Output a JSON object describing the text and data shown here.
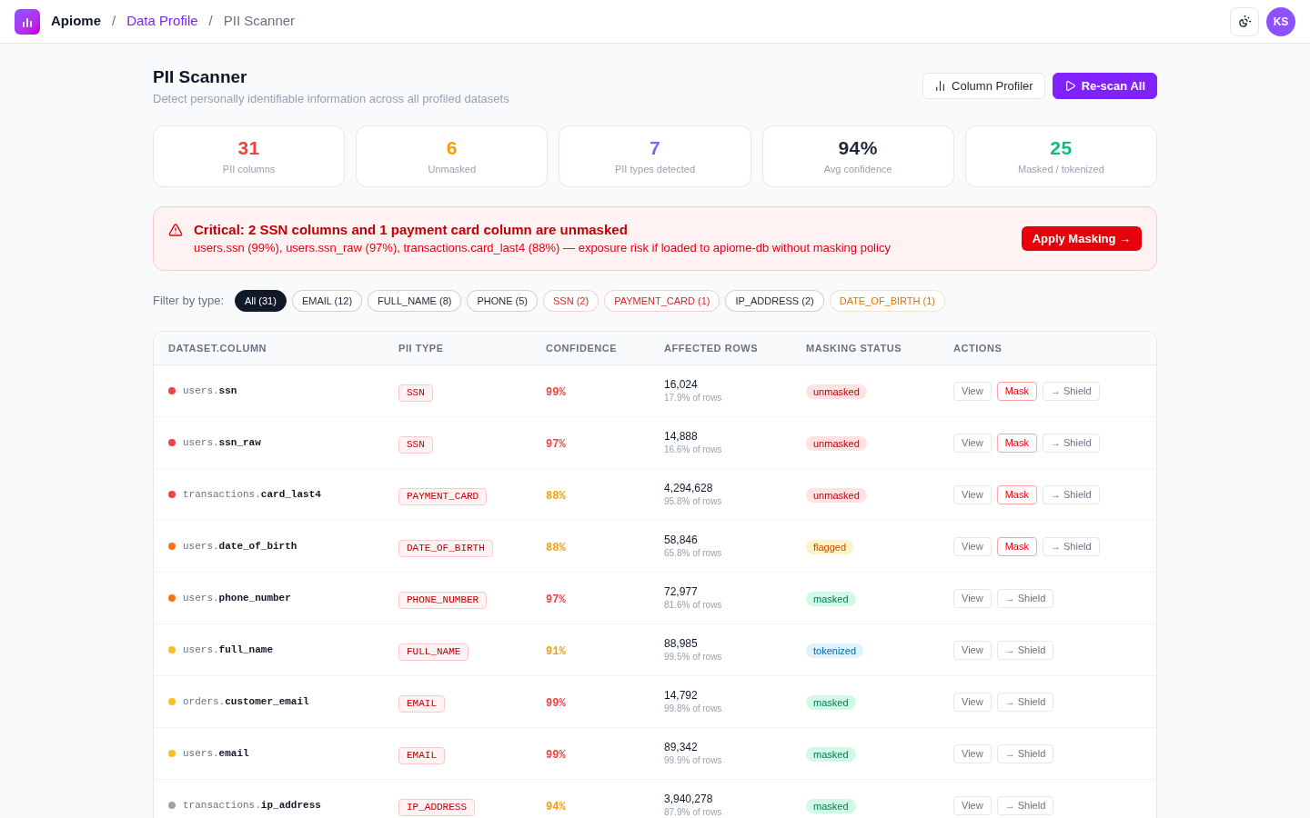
{
  "topbar": {
    "breadcrumbs": [
      {
        "label": "Apiome",
        "kind": "brand"
      },
      {
        "label": "Data Profile",
        "kind": "link",
        "separator": "/"
      },
      {
        "label": "PII Scanner",
        "kind": "current",
        "separator": "/"
      }
    ],
    "avatar": "KS"
  },
  "header": {
    "title": "PII Scanner",
    "subtitle": "Detect personally identifiable information across all profiled datasets",
    "buttons": [
      {
        "label": "Column Profiler",
        "kind": "secondary"
      },
      {
        "label": "Re-scan All",
        "kind": "primary"
      }
    ]
  },
  "stats": [
    {
      "value": "31",
      "label": "PII columns",
      "color": "#ef4444"
    },
    {
      "value": "6",
      "label": "Unmasked",
      "color": "#f59e0b"
    },
    {
      "value": "7",
      "label": "PII types detected",
      "color": "#8b5cf6"
    },
    {
      "value": "94%",
      "label": "Avg confidence",
      "color": "#1f2937"
    },
    {
      "value": "25",
      "label": "Masked / tokenized",
      "color": "#10b981"
    }
  ],
  "alert": {
    "title": "Critical: 2 SSN columns and 1 payment card column are unmasked",
    "detail": "users.ssn (99%), users.ssn_raw (97%), transactions.card_last4 (88%) — exposure risk if loaded to apiome-db without masking policy",
    "action": "Apply Masking →"
  },
  "filters": {
    "label": "Filter by type:",
    "options": [
      {
        "label": "All (31)",
        "selected": true,
        "color": "#111827"
      },
      {
        "label": "EMAIL (12)",
        "selected": false,
        "color": "#1f2937"
      },
      {
        "label": "FULL_NAME (8)",
        "selected": false,
        "color": "#1f2937"
      },
      {
        "label": "PHONE (5)",
        "selected": false,
        "color": "#1f2937"
      },
      {
        "label": "SSN (2)",
        "selected": false,
        "color": "#dc2626"
      },
      {
        "label": "PAYMENT_CARD (1)",
        "selected": false,
        "color": "#dc2626"
      },
      {
        "label": "IP_ADDRESS (2)",
        "selected": false,
        "color": "#1f2937"
      },
      {
        "label": "DATE_OF_BIRTH (1)",
        "selected": false,
        "color": "#d97706"
      }
    ]
  },
  "table": {
    "columns": [
      "DATASET.COLUMN",
      "PII TYPE",
      "CONFIDENCE",
      "AFFECTED ROWS",
      "MASKING STATUS",
      "ACTIONS"
    ],
    "rows": [
      {
        "column": "users.**ssn**",
        "color": "#ef4444",
        "pii_type": "SSN",
        "confidence": {
          "text": "99%",
          "color": "#ef4444"
        },
        "affected": "16,024",
        "share": "17.9% of rows",
        "status": {
          "label": "unmasked",
          "kind": "danger"
        },
        "actions": [
          {
            "label": "View",
            "kind": "default"
          },
          {
            "label": "Mask",
            "kind": "danger"
          },
          {
            "label": "→ Shield",
            "kind": "default"
          }
        ]
      },
      {
        "column": "users.**ssn_raw**",
        "color": "#ef4444",
        "pii_type": "SSN",
        "confidence": {
          "text": "97%",
          "color": "#ef4444"
        },
        "affected": "14,888",
        "share": "16.6% of rows",
        "status": {
          "label": "unmasked",
          "kind": "danger"
        },
        "actions": [
          {
            "label": "View",
            "kind": "default"
          },
          {
            "label": "Mask",
            "kind": "danger"
          },
          {
            "label": "→ Shield",
            "kind": "default"
          }
        ]
      },
      {
        "column": "transactions.**card_last4**",
        "color": "#ef4444",
        "pii_type": "PAYMENT_CARD",
        "confidence": {
          "text": "88%",
          "color": "#f59e0b"
        },
        "affected": "4,294,628",
        "share": "95.8% of rows",
        "status": {
          "label": "unmasked",
          "kind": "danger"
        },
        "actions": [
          {
            "label": "View",
            "kind": "default"
          },
          {
            "label": "Mask",
            "kind": "danger"
          },
          {
            "label": "→ Shield",
            "kind": "default"
          }
        ]
      },
      {
        "column": "users.**date_of_birth**",
        "color": "#f97316",
        "pii_type": "DATE_OF_BIRTH",
        "confidence": {
          "text": "88%",
          "color": "#f59e0b"
        },
        "affected": "58,846",
        "share": "65.8% of rows",
        "status": {
          "label": "flagged",
          "kind": "warning"
        },
        "actions": [
          {
            "label": "View",
            "kind": "default"
          },
          {
            "label": "Mask",
            "kind": "danger"
          },
          {
            "label": "→ Shield",
            "kind": "default"
          }
        ]
      },
      {
        "column": "users.**phone_number**",
        "color": "#f97316",
        "pii_type": "PHONE_NUMBER",
        "confidence": {
          "text": "97%",
          "color": "#ef4444"
        },
        "affected": "72,977",
        "share": "81.6% of rows",
        "status": {
          "label": "masked",
          "kind": "success"
        },
        "actions": [
          {
            "label": "View",
            "kind": "default"
          },
          {
            "label": "→ Shield",
            "kind": "default"
          }
        ]
      },
      {
        "column": "users.**full_name**",
        "color": "#fbbf24",
        "pii_type": "FULL_NAME",
        "confidence": {
          "text": "91%",
          "color": "#f59e0b"
        },
        "affected": "88,985",
        "share": "99.5% of rows",
        "status": {
          "label": "tokenized",
          "kind": "info"
        },
        "actions": [
          {
            "label": "View",
            "kind": "default"
          },
          {
            "label": "→ Shield",
            "kind": "default"
          }
        ]
      },
      {
        "column": "orders.**customer_email**",
        "color": "#fbbf24",
        "pii_type": "EMAIL",
        "confidence": {
          "text": "99%",
          "color": "#ef4444"
        },
        "affected": "14,792",
        "share": "99.8% of rows",
        "status": {
          "label": "masked",
          "kind": "success"
        },
        "actions": [
          {
            "label": "View",
            "kind": "default"
          },
          {
            "label": "→ Shield",
            "kind": "default"
          }
        ]
      },
      {
        "column": "users.**email**",
        "color": "#fbbf24",
        "pii_type": "EMAIL",
        "confidence": {
          "text": "99%",
          "color": "#ef4444"
        },
        "affected": "89,342",
        "share": "99.9% of rows",
        "status": {
          "label": "masked",
          "kind": "success"
        },
        "actions": [
          {
            "label": "View",
            "kind": "default"
          },
          {
            "label": "→ Shield",
            "kind": "default"
          }
        ]
      },
      {
        "column": "transactions.**ip_address**",
        "color": "#9ca3af",
        "pii_type": "IP_ADDRESS",
        "confidence": {
          "text": "94%",
          "color": "#f59e0b"
        },
        "affected": "3,940,278",
        "share": "87.9% of rows",
        "status": {
          "label": "masked",
          "kind": "success"
        },
        "actions": [
          {
            "label": "View",
            "kind": "default"
          },
          {
            "label": "→ Shield",
            "kind": "default"
          }
        ]
      }
    ]
  }
}
